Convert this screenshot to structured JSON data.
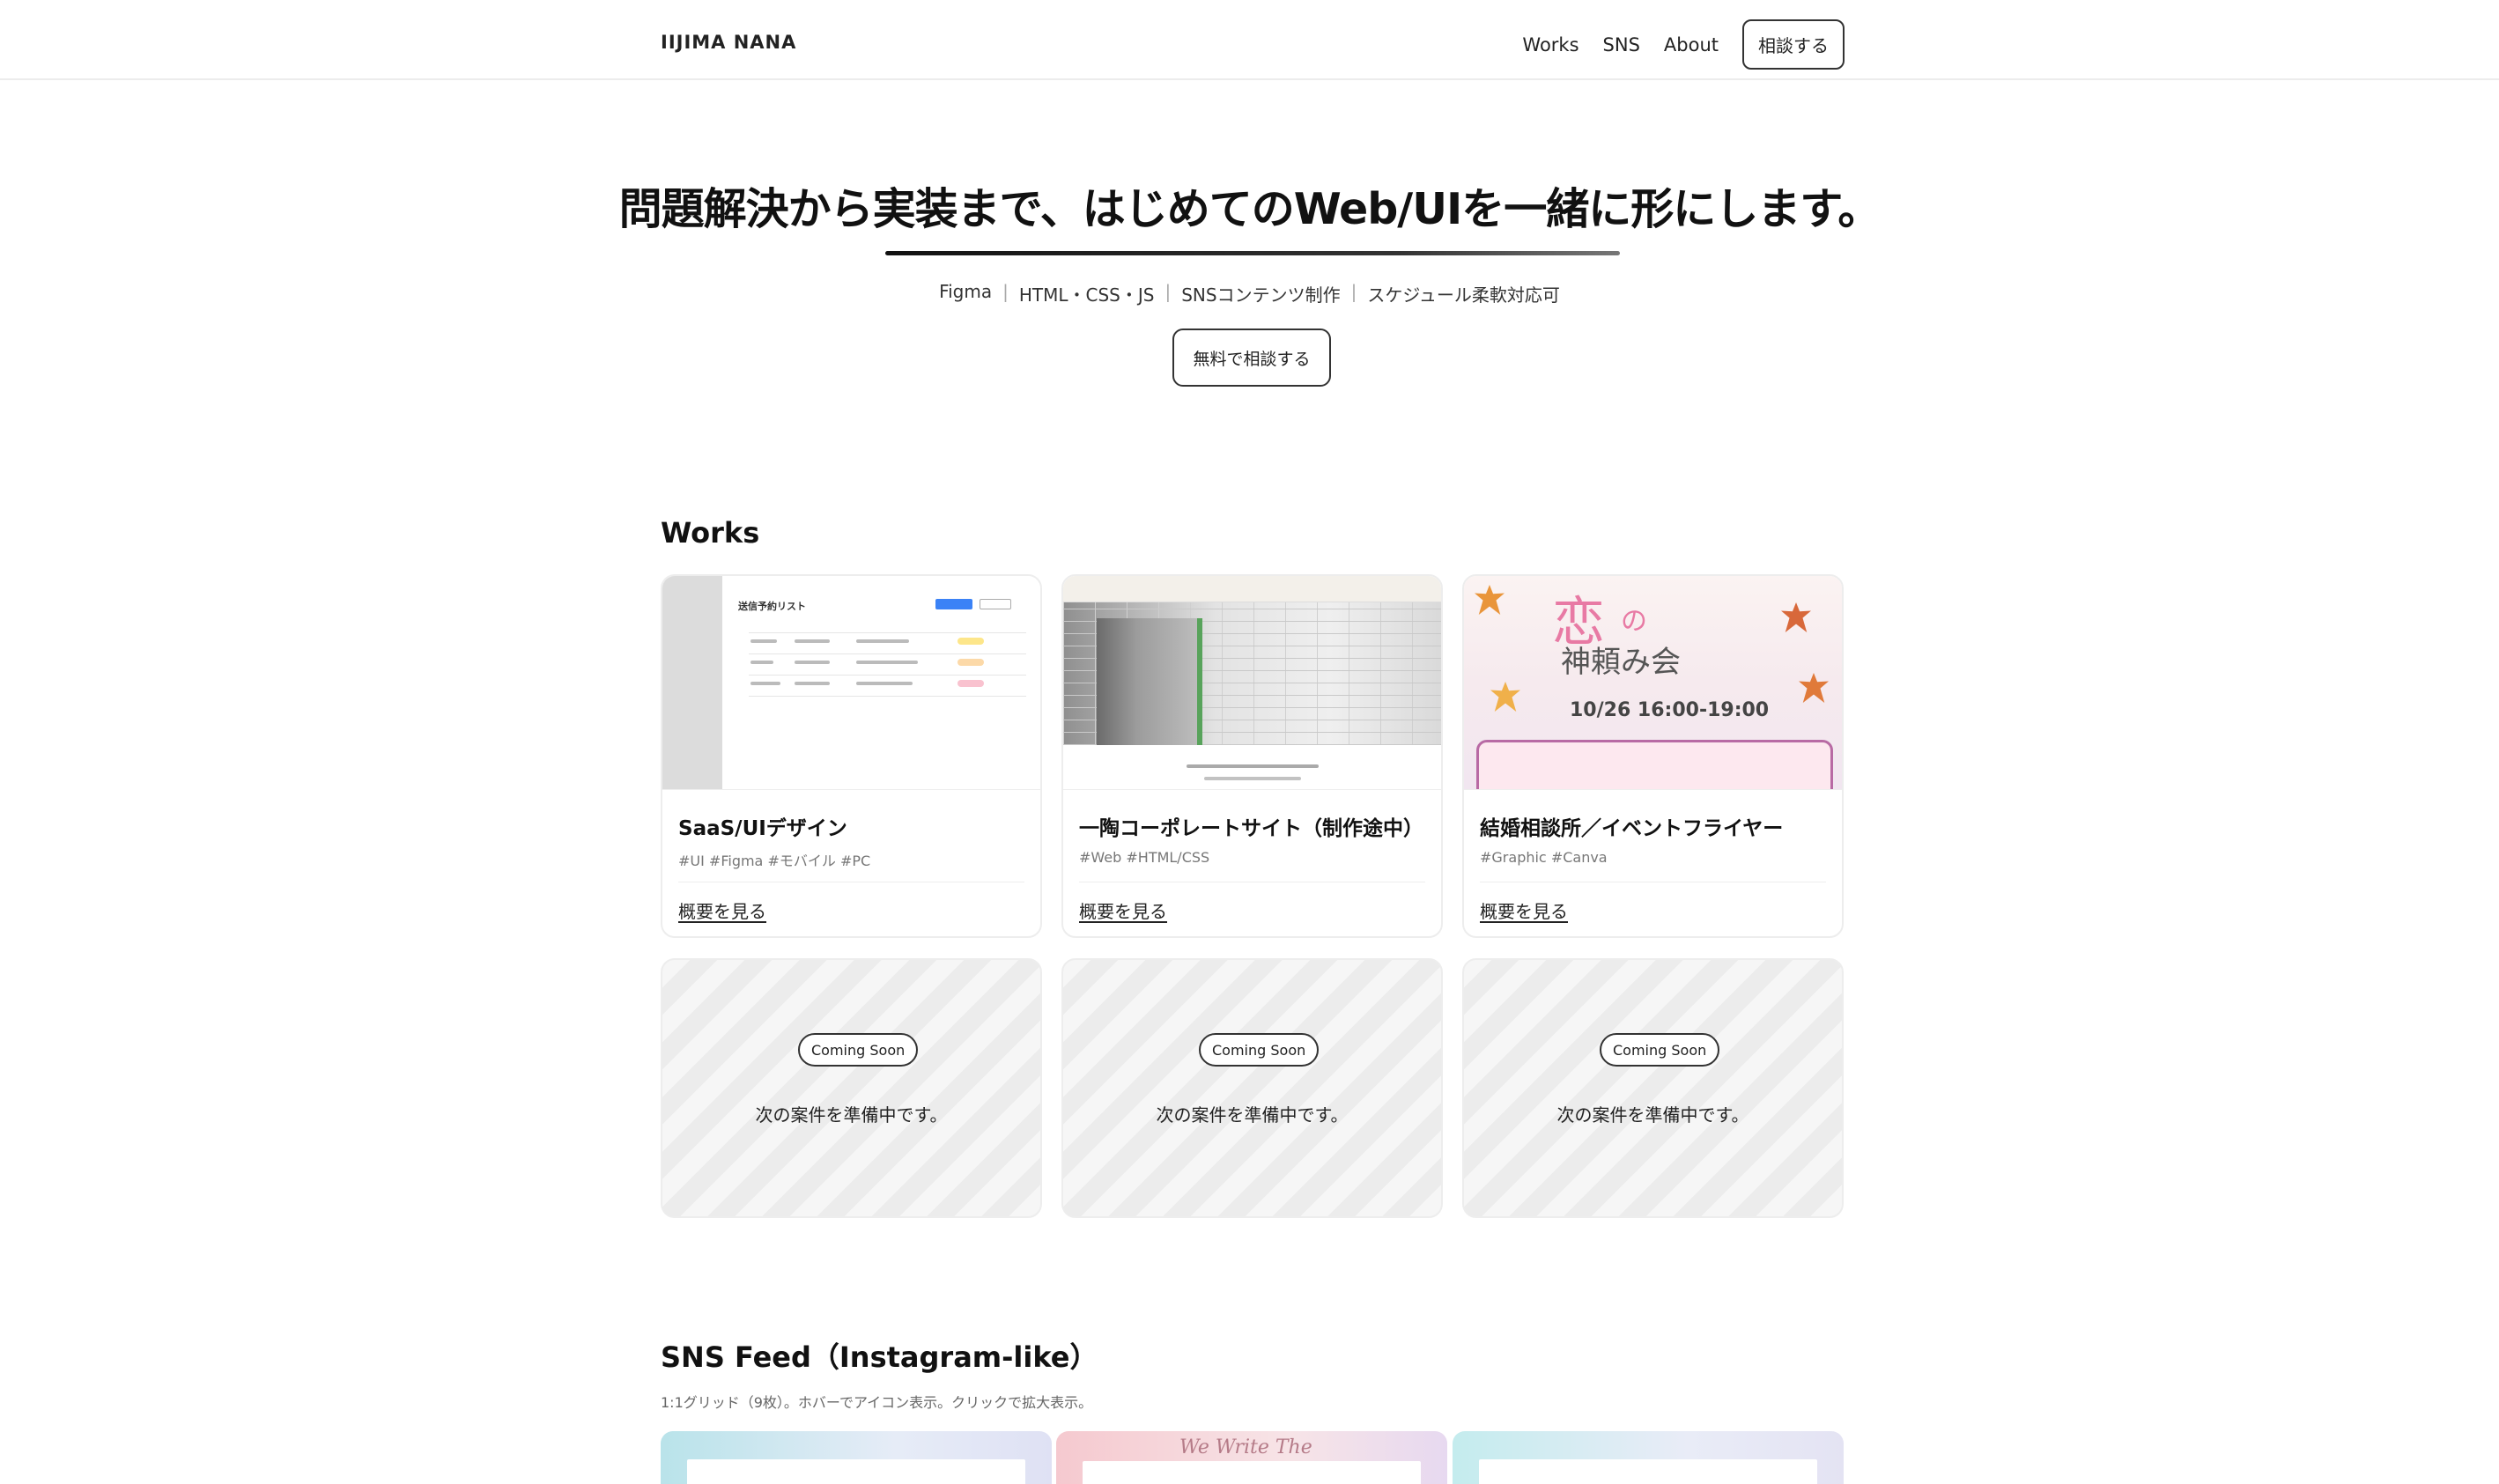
{
  "header": {
    "brand": "IIJIMA NANA",
    "nav": {
      "works": "Works",
      "sns": "SNS",
      "about": "About",
      "consult": "相談する"
    }
  },
  "hero": {
    "title": "問題解決から実装まで、はじめてのWeb/UIを一緒に形にします。",
    "skills": [
      "Figma",
      "HTML・CSS・JS",
      "SNSコンテンツ制作",
      "スケジュール柔軟対応可"
    ],
    "skill_separator": "|",
    "cta": "無料で相談する"
  },
  "works": {
    "title": "Works",
    "items": [
      {
        "title": "SaaS/UIデザイン",
        "tags": "#UI #Figma #モバイル #PC",
        "link": "概要を見る",
        "thumb_heading": "送信予約リスト"
      },
      {
        "title": "一陶コーポレートサイト（制作途中）",
        "tags": "#Web #HTML/CSS",
        "link": "概要を見る"
      },
      {
        "title": "結婚相談所／イベントフライヤー",
        "tags": "#Graphic #Canva",
        "link": "概要を見る",
        "flyer": {
          "big": "恋",
          "no": "の",
          "main": "神頼み会",
          "date": "10/26 16:00-19:00"
        }
      }
    ],
    "coming_soon": [
      {
        "badge": "Coming Soon",
        "text": "次の案件を準備中です。"
      },
      {
        "badge": "Coming Soon",
        "text": "次の案件を準備中です。"
      },
      {
        "badge": "Coming Soon",
        "text": "次の案件を準備中です。"
      }
    ]
  },
  "sns": {
    "title": "SNS Feed（Instagram-like）",
    "subtitle": "1:1グリッド（9枚）。ホバーでアイコン表示。クリックで拡大表示。",
    "thumb2_script": "We  Write  The"
  },
  "colors": {
    "text": "#1c1c1c",
    "border": "#333333",
    "accent_blue": "#3b82f6",
    "flyer_pink": "#e87aa4"
  },
  "icons": {
    "leaf": "maple-leaf-icon"
  }
}
